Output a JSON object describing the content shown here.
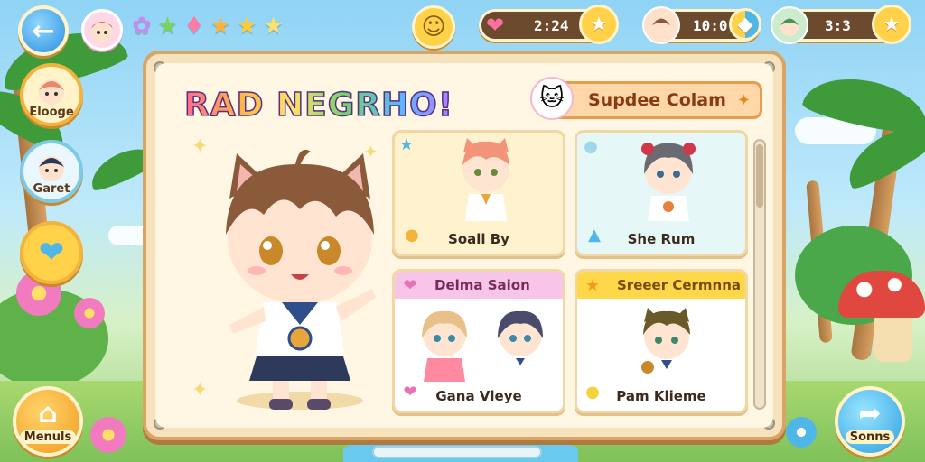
{
  "top_bar": {
    "back_icon": "back-arrow-icon",
    "stars": [
      "purple-star",
      "green-star",
      "pink-star",
      "orange-star",
      "gold-star",
      "yellow-star"
    ],
    "star_colors": [
      "#c58cf0",
      "#7ad35c",
      "#ff7aa8",
      "#ffb23a",
      "#ffcc2e",
      "#ffe066"
    ],
    "hearts_value": "2:24",
    "friends_value": "10:0",
    "team_value": "3:3"
  },
  "game_title": "RAD NEGRHO!",
  "side_menu": [
    {
      "label": "Elooge"
    },
    {
      "label": "Garet"
    }
  ],
  "bottom_left": {
    "label": "Menuls"
  },
  "bottom_right": {
    "label": "Sonns"
  },
  "collection": {
    "header_title": "Supdee Colam",
    "cards": [
      {
        "name": "Soall By"
      },
      {
        "name": "She Rum"
      },
      {
        "banner": "Delma Saion",
        "name": "Gana Vleye"
      },
      {
        "banner": "Sreeer Cermnna",
        "name": "Pam Klieme"
      }
    ]
  },
  "colors": {
    "panel": "#f6e2bd",
    "accent_orange": "#f3b33d",
    "banner_pink": "#f7c5e8",
    "banner_yellow": "#ffd84a"
  }
}
